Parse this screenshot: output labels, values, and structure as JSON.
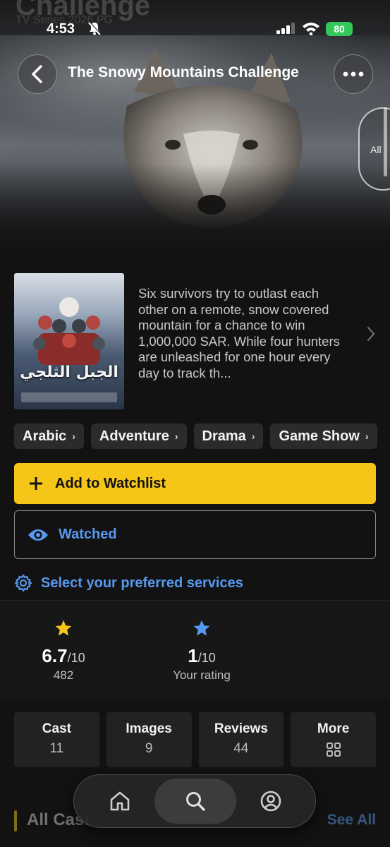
{
  "status_bar": {
    "time": "4:53",
    "battery": "80"
  },
  "hero": {
    "ghost_title": "Challenge",
    "ghost_meta": "TV Series   2026   PG",
    "all_label": "All"
  },
  "nav": {
    "title": "The Snowy Mountains Challenge"
  },
  "poster": {
    "title_ar": "الجبل الثلجي"
  },
  "description": "Six survivors try to outlast each other on a remote, snow covered mountain for a chance to win 1,000,000 SAR. While four hunters are unleashed for one hour every day to track th...",
  "genres": [
    "Arabic",
    "Adventure",
    "Drama",
    "Game Show"
  ],
  "actions": {
    "watchlist": "Add to Watchlist",
    "watched": "Watched",
    "services": "Select your preferred services"
  },
  "ratings": {
    "imdb": {
      "score": "6.7",
      "out_of": "/10",
      "count": "482"
    },
    "user": {
      "score": "1",
      "out_of": "/10",
      "label": "Your rating"
    }
  },
  "tiles": [
    {
      "label": "Cast",
      "value": "11"
    },
    {
      "label": "Images",
      "value": "9"
    },
    {
      "label": "Reviews",
      "value": "44"
    },
    {
      "label": "More",
      "icon": "grid-icon"
    }
  ],
  "section": {
    "title": "All Cast",
    "see_all": "See All"
  },
  "colors": {
    "accent": "#f5c518",
    "link": "#5799ef",
    "battery": "#34c759"
  }
}
